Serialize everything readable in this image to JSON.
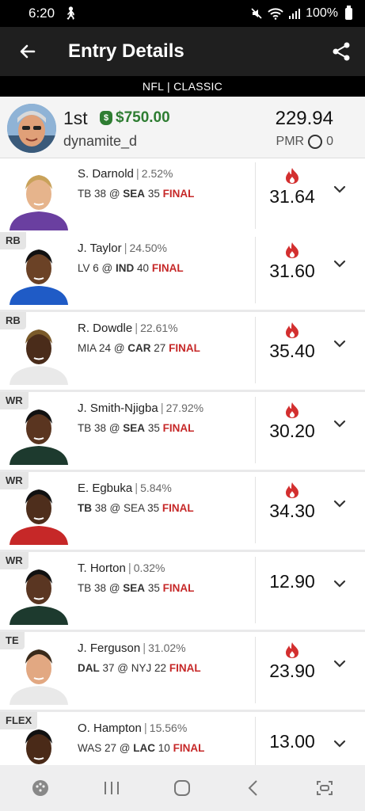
{
  "status": {
    "time": "6:20",
    "battery": "100%"
  },
  "header": {
    "title": "Entry Details"
  },
  "sub_header": "NFL | CLASSIC",
  "summary": {
    "rank": "1st",
    "prize": "$750.00",
    "username": "dynamite_d",
    "score": "229.94",
    "pmr_label": "PMR",
    "pmr_value": "0"
  },
  "players": [
    {
      "position": "",
      "name": "S. Darnold",
      "ownership": "2.52%",
      "team1": "TB",
      "score1": "38",
      "team2": "SEA",
      "score2": "35",
      "bold": 2,
      "status": "FINAL",
      "points": "31.64",
      "flame": true
    },
    {
      "position": "RB",
      "name": "J. Taylor",
      "ownership": "24.50%",
      "team1": "LV",
      "score1": "6",
      "team2": "IND",
      "score2": "40",
      "bold": 2,
      "status": "FINAL",
      "points": "31.60",
      "flame": true
    },
    {
      "position": "RB",
      "name": "R. Dowdle",
      "ownership": "22.61%",
      "team1": "MIA",
      "score1": "24",
      "team2": "CAR",
      "score2": "27",
      "bold": 2,
      "status": "FINAL",
      "points": "35.40",
      "flame": true
    },
    {
      "position": "WR",
      "name": "J. Smith-Njigba",
      "ownership": "27.92%",
      "team1": "TB",
      "score1": "38",
      "team2": "SEA",
      "score2": "35",
      "bold": 2,
      "status": "FINAL",
      "points": "30.20",
      "flame": true
    },
    {
      "position": "WR",
      "name": "E. Egbuka",
      "ownership": "5.84%",
      "team1": "TB",
      "score1": "38",
      "team2": "SEA",
      "score2": "35",
      "bold": 1,
      "status": "FINAL",
      "points": "34.30",
      "flame": true
    },
    {
      "position": "WR",
      "name": "T. Horton",
      "ownership": "0.32%",
      "team1": "TB",
      "score1": "38",
      "team2": "SEA",
      "score2": "35",
      "bold": 2,
      "status": "FINAL",
      "points": "12.90",
      "flame": false
    },
    {
      "position": "TE",
      "name": "J. Ferguson",
      "ownership": "31.02%",
      "team1": "DAL",
      "score1": "37",
      "team2": "NYJ",
      "score2": "22",
      "bold": 1,
      "status": "FINAL",
      "points": "23.90",
      "flame": true
    },
    {
      "position": "FLEX",
      "name": "O. Hampton",
      "ownership": "15.56%",
      "team1": "WAS",
      "score1": "27",
      "team2": "LAC",
      "score2": "10",
      "bold": 2,
      "status": "FINAL",
      "points": "13.00",
      "flame": false
    }
  ],
  "colors": {
    "accent_green": "#2e7d32",
    "final_red": "#c62828",
    "flame_red": "#d32f2f",
    "header_bg": "#1f1f1f"
  },
  "icons": [
    "back-arrow-icon",
    "share-icon",
    "money-bag-icon",
    "flame-icon",
    "chevron-down-icon"
  ]
}
